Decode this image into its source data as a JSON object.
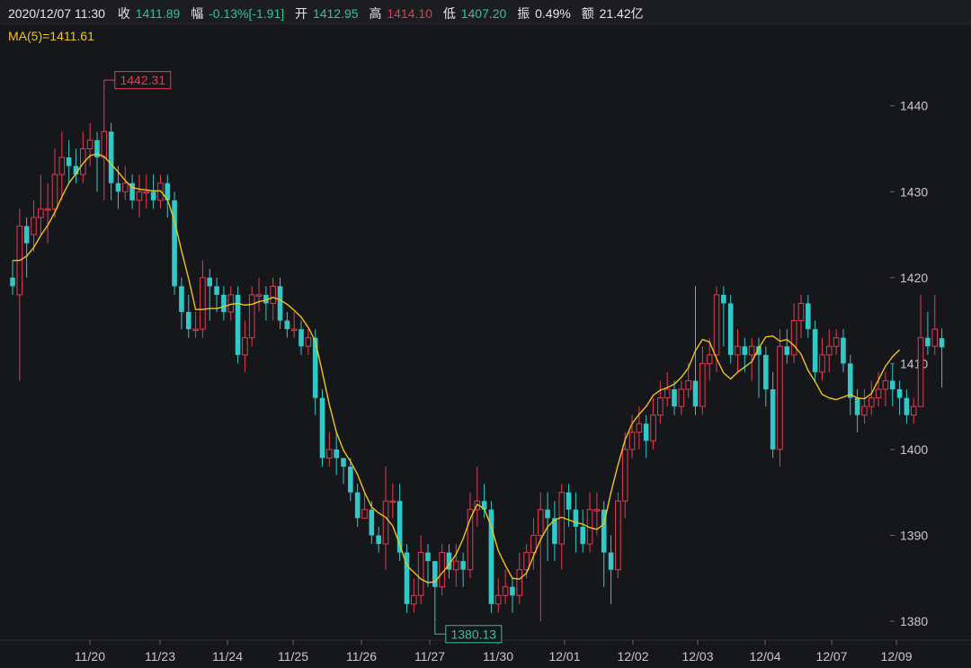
{
  "header": {
    "datetime": "2020/12/07 11:30",
    "close_label": "收",
    "close_value": "1411.89",
    "change_label": "幅",
    "change_value": "-0.13%[-1.91]",
    "open_label": "开",
    "open_value": "1412.95",
    "high_label": "高",
    "high_value": "1414.10",
    "low_label": "低",
    "low_value": "1407.20",
    "amplitude_label": "振",
    "amplitude_value": "0.49%",
    "amount_label": "额",
    "amount_value": "21.42亿"
  },
  "ma_legend": "MA(5)=1411.61",
  "colors": {
    "up": "#e43a52",
    "down": "#32c8c8",
    "ma": "#f0c419",
    "background": "#16171b",
    "grid": "#26272b"
  },
  "chart_data": {
    "type": "candlestick",
    "y_ticks": [
      1380,
      1390,
      1400,
      1410,
      1420,
      1430,
      1440
    ],
    "ylim": [
      1378,
      1450
    ],
    "x_tick_labels": [
      "11/20",
      "11/23",
      "11/24",
      "11/25",
      "11/26",
      "11/27",
      "11/30",
      "12/01",
      "12/02",
      "12/03",
      "12/04",
      "12/07",
      "12/09"
    ],
    "grid": false,
    "annotations": [
      {
        "label": "1442.31",
        "value": 1442.31,
        "kind": "high",
        "index": 13
      },
      {
        "label": "1380.13",
        "value": 1380.13,
        "kind": "low",
        "index": 60
      }
    ],
    "candles": [
      [
        1420.0,
        1419.0,
        1422.0,
        1418.0
      ],
      [
        1418.0,
        1426.0,
        1428.0,
        1408.0
      ],
      [
        1426.0,
        1424.0,
        1427.0,
        1420.0
      ],
      [
        1425.0,
        1427.0,
        1429.0,
        1423.0
      ],
      [
        1427.0,
        1428.0,
        1432.0,
        1425.0
      ],
      [
        1428.0,
        1428.0,
        1431.0,
        1424.0
      ],
      [
        1428.0,
        1432.0,
        1435.0,
        1427.0
      ],
      [
        1432.0,
        1434.0,
        1437.0,
        1429.0
      ],
      [
        1434.0,
        1433.0,
        1436.0,
        1431.0
      ],
      [
        1433.0,
        1432.0,
        1435.0,
        1431.0
      ],
      [
        1432.0,
        1435.0,
        1437.0,
        1431.0
      ],
      [
        1435.0,
        1436.0,
        1438.0,
        1433.0
      ],
      [
        1436.0,
        1434.0,
        1437.0,
        1430.0
      ],
      [
        1434.0,
        1437.0,
        1442.31,
        1429.0
      ],
      [
        1437.0,
        1431.0,
        1438.0,
        1429.0
      ],
      [
        1431.0,
        1430.0,
        1433.0,
        1428.0
      ],
      [
        1430.0,
        1431.0,
        1433.0,
        1429.0
      ],
      [
        1431.0,
        1429.0,
        1432.0,
        1428.0
      ],
      [
        1429.0,
        1430.0,
        1432.0,
        1427.0
      ],
      [
        1430.0,
        1430.0,
        1432.0,
        1428.0
      ],
      [
        1430.0,
        1429.0,
        1432.0,
        1428.0
      ],
      [
        1429.0,
        1431.0,
        1432.0,
        1428.0
      ],
      [
        1431.0,
        1429.0,
        1432.0,
        1427.0
      ],
      [
        1429.0,
        1419.0,
        1430.0,
        1418.0
      ],
      [
        1419.0,
        1416.0,
        1420.0,
        1414.0
      ],
      [
        1416.0,
        1414.0,
        1418.0,
        1413.0
      ],
      [
        1414.0,
        1414.0,
        1416.0,
        1413.0
      ],
      [
        1414.0,
        1420.0,
        1422.0,
        1413.0
      ],
      [
        1420.0,
        1419.0,
        1421.0,
        1415.0
      ],
      [
        1419.0,
        1418.0,
        1420.0,
        1416.0
      ],
      [
        1418.0,
        1416.0,
        1419.0,
        1415.0
      ],
      [
        1416.0,
        1418.0,
        1419.0,
        1415.0
      ],
      [
        1418.0,
        1411.0,
        1419.0,
        1410.0
      ],
      [
        1411.0,
        1413.0,
        1415.0,
        1409.0
      ],
      [
        1413.0,
        1418.0,
        1419.0,
        1412.0
      ],
      [
        1418.0,
        1418.0,
        1420.0,
        1416.0
      ],
      [
        1418.0,
        1417.0,
        1419.0,
        1415.0
      ],
      [
        1417.0,
        1419.0,
        1420.0,
        1415.0
      ],
      [
        1419.0,
        1415.0,
        1420.0,
        1414.0
      ],
      [
        1415.0,
        1414.0,
        1416.0,
        1413.0
      ],
      [
        1414.0,
        1414.0,
        1416.0,
        1413.0
      ],
      [
        1414.0,
        1412.0,
        1415.0,
        1411.0
      ],
      [
        1412.0,
        1413.0,
        1414.0,
        1411.0
      ],
      [
        1413.0,
        1406.0,
        1414.0,
        1404.0
      ],
      [
        1406.0,
        1399.0,
        1407.0,
        1398.0
      ],
      [
        1399.0,
        1400.0,
        1402.0,
        1398.0
      ],
      [
        1400.0,
        1399.0,
        1402.0,
        1397.0
      ],
      [
        1399.0,
        1398.0,
        1399.0,
        1396.0
      ],
      [
        1398.0,
        1395.0,
        1399.0,
        1394.0
      ],
      [
        1395.0,
        1392.0,
        1396.0,
        1391.0
      ],
      [
        1392.0,
        1393.0,
        1395.0,
        1392.0
      ],
      [
        1393.0,
        1390.0,
        1394.0,
        1389.0
      ],
      [
        1390.0,
        1389.0,
        1391.0,
        1388.0
      ],
      [
        1389.0,
        1394.0,
        1398.0,
        1386.0
      ],
      [
        1394.0,
        1394.0,
        1396.0,
        1392.0
      ],
      [
        1394.0,
        1388.0,
        1396.0,
        1387.0
      ],
      [
        1388.0,
        1382.0,
        1389.0,
        1381.0
      ],
      [
        1382.0,
        1383.0,
        1385.0,
        1381.0
      ],
      [
        1383.0,
        1388.0,
        1390.0,
        1382.0
      ],
      [
        1388.0,
        1387.0,
        1389.0,
        1384.0
      ],
      [
        1387.0,
        1384.0,
        1387.0,
        1380.13
      ],
      [
        1384.0,
        1388.0,
        1389.0,
        1383.0
      ],
      [
        1388.0,
        1386.0,
        1389.0,
        1385.0
      ],
      [
        1386.0,
        1387.0,
        1389.0,
        1384.0
      ],
      [
        1387.0,
        1386.0,
        1388.0,
        1384.0
      ],
      [
        1386.0,
        1393.0,
        1395.0,
        1385.0
      ],
      [
        1393.0,
        1394.0,
        1398.0,
        1391.0
      ],
      [
        1394.0,
        1393.0,
        1396.0,
        1392.0
      ],
      [
        1393.0,
        1382.0,
        1394.0,
        1381.0
      ],
      [
        1382.0,
        1383.0,
        1385.0,
        1381.0
      ],
      [
        1383.0,
        1384.0,
        1386.0,
        1382.0
      ],
      [
        1384.0,
        1383.0,
        1385.0,
        1381.0
      ],
      [
        1383.0,
        1386.0,
        1388.0,
        1382.0
      ],
      [
        1386.0,
        1388.0,
        1389.0,
        1385.0
      ],
      [
        1388.0,
        1390.0,
        1392.0,
        1386.0
      ],
      [
        1390.0,
        1393.0,
        1395.0,
        1380.0
      ],
      [
        1393.0,
        1392.0,
        1395.0,
        1387.0
      ],
      [
        1392.0,
        1389.0,
        1394.0,
        1387.0
      ],
      [
        1389.0,
        1395.0,
        1396.0,
        1386.0
      ],
      [
        1395.0,
        1393.0,
        1396.0,
        1391.0
      ],
      [
        1393.0,
        1391.0,
        1395.0,
        1388.0
      ],
      [
        1391.0,
        1389.0,
        1393.0,
        1388.0
      ],
      [
        1389.0,
        1393.0,
        1395.0,
        1388.0
      ],
      [
        1393.0,
        1393.0,
        1395.0,
        1390.0
      ],
      [
        1393.0,
        1388.0,
        1394.0,
        1384.0
      ],
      [
        1388.0,
        1386.0,
        1390.0,
        1382.0
      ],
      [
        1386.0,
        1394.0,
        1395.0,
        1385.0
      ],
      [
        1394.0,
        1400.0,
        1402.0,
        1392.0
      ],
      [
        1400.0,
        1402.0,
        1404.0,
        1399.0
      ],
      [
        1402.0,
        1403.0,
        1405.0,
        1400.0
      ],
      [
        1403.0,
        1401.0,
        1404.0,
        1399.0
      ],
      [
        1401.0,
        1404.0,
        1406.0,
        1400.0
      ],
      [
        1404.0,
        1406.0,
        1408.0,
        1403.0
      ],
      [
        1406.0,
        1407.0,
        1409.0,
        1405.0
      ],
      [
        1407.0,
        1405.0,
        1408.0,
        1404.0
      ],
      [
        1405.0,
        1407.0,
        1408.0,
        1404.0
      ],
      [
        1407.0,
        1408.0,
        1410.0,
        1406.0
      ],
      [
        1408.0,
        1405.0,
        1419.0,
        1404.0
      ],
      [
        1405.0,
        1410.0,
        1412.0,
        1404.0
      ],
      [
        1410.0,
        1411.0,
        1413.0,
        1408.0
      ],
      [
        1411.0,
        1418.0,
        1419.0,
        1409.0
      ],
      [
        1418.0,
        1417.0,
        1419.0,
        1412.0
      ],
      [
        1417.0,
        1411.0,
        1418.0,
        1410.0
      ],
      [
        1411.0,
        1412.0,
        1414.0,
        1409.0
      ],
      [
        1412.0,
        1411.0,
        1413.0,
        1409.0
      ],
      [
        1411.0,
        1412.0,
        1413.0,
        1408.0
      ],
      [
        1412.0,
        1411.0,
        1413.0,
        1406.0
      ],
      [
        1411.0,
        1407.0,
        1412.0,
        1405.0
      ],
      [
        1407.0,
        1400.0,
        1409.0,
        1399.0
      ],
      [
        1400.0,
        1412.0,
        1414.0,
        1398.0
      ],
      [
        1412.0,
        1411.0,
        1414.0,
        1410.0
      ],
      [
        1411.0,
        1415.0,
        1417.0,
        1410.0
      ],
      [
        1415.0,
        1417.0,
        1418.0,
        1413.0
      ],
      [
        1417.0,
        1414.0,
        1418.0,
        1413.0
      ],
      [
        1414.0,
        1409.0,
        1415.0,
        1408.0
      ],
      [
        1409.0,
        1411.0,
        1413.0,
        1408.0
      ],
      [
        1411.0,
        1412.0,
        1414.0,
        1409.0
      ],
      [
        1412.0,
        1413.0,
        1414.0,
        1411.0
      ],
      [
        1413.0,
        1410.0,
        1414.0,
        1409.0
      ],
      [
        1410.0,
        1406.0,
        1411.0,
        1404.0
      ],
      [
        1406.0,
        1404.0,
        1407.0,
        1402.0
      ],
      [
        1404.0,
        1405.0,
        1407.0,
        1403.0
      ],
      [
        1405.0,
        1406.0,
        1408.0,
        1404.0
      ],
      [
        1406.0,
        1407.0,
        1409.0,
        1405.0
      ],
      [
        1407.0,
        1408.0,
        1409.0,
        1405.0
      ],
      [
        1408.0,
        1407.0,
        1410.0,
        1405.0
      ],
      [
        1407.0,
        1406.0,
        1408.0,
        1404.0
      ],
      [
        1406.0,
        1404.0,
        1407.0,
        1403.0
      ],
      [
        1404.0,
        1405.0,
        1406.0,
        1403.0
      ],
      [
        1405.0,
        1413.0,
        1418.0,
        1408.0
      ],
      [
        1413.0,
        1412.0,
        1416.0,
        1411.0
      ],
      [
        1412.0,
        1414.0,
        1418.0,
        1411.0
      ],
      [
        1412.95,
        1411.89,
        1414.1,
        1407.2
      ]
    ],
    "ma5": [
      1422.0,
      1422.0,
      1422.5,
      1423.5,
      1424.9,
      1426.1,
      1427.6,
      1429.4,
      1431.0,
      1432.1,
      1433.3,
      1434.2,
      1434.4,
      1434.1,
      1433.2,
      1432.3,
      1431.3,
      1430.5,
      1430.3,
      1430.2,
      1430.1,
      1430.1,
      1429.1,
      1426.6,
      1423.1,
      1419.9,
      1416.3,
      1416.3,
      1416.4,
      1416.4,
      1416.6,
      1416.9,
      1417.0,
      1416.8,
      1416.9,
      1417.2,
      1417.4,
      1417.7,
      1417.4,
      1416.9,
      1416.2,
      1415.4,
      1414.2,
      1412.6,
      1409.0,
      1405.2,
      1402.0,
      1399.9,
      1398.6,
      1397.1,
      1395.0,
      1393.3,
      1392.6,
      1392.1,
      1391.1,
      1388.9,
      1386.5,
      1385.7,
      1384.9,
      1384.5,
      1384.6,
      1385.6,
      1386.6,
      1387.8,
      1389.6,
      1391.9,
      1393.6,
      1393.1,
      1391.0,
      1388.2,
      1386.5,
      1385.0,
      1384.9,
      1385.6,
      1387.6,
      1389.5,
      1391.0,
      1391.8,
      1392.1,
      1391.8,
      1391.5,
      1391.3,
      1390.9,
      1390.7,
      1391.3,
      1395.0,
      1398.2,
      1401.1,
      1403.0,
      1404.1,
      1405.0,
      1406.3,
      1406.9,
      1407.2,
      1407.6,
      1408.4,
      1409.5,
      1411.5,
      1412.8,
      1412.5,
      1410.6,
      1408.9,
      1408.2,
      1409.0,
      1409.6,
      1410.2,
      1411.8,
      1413.1,
      1413.2,
      1412.6,
      1412.8,
      1412.1,
      1411.1,
      1409.2,
      1407.9,
      1406.4,
      1406.0,
      1405.8,
      1406.1,
      1406.4,
      1406.0,
      1405.9,
      1406.5,
      1408.1,
      1409.7,
      1410.8,
      1411.61
    ]
  }
}
